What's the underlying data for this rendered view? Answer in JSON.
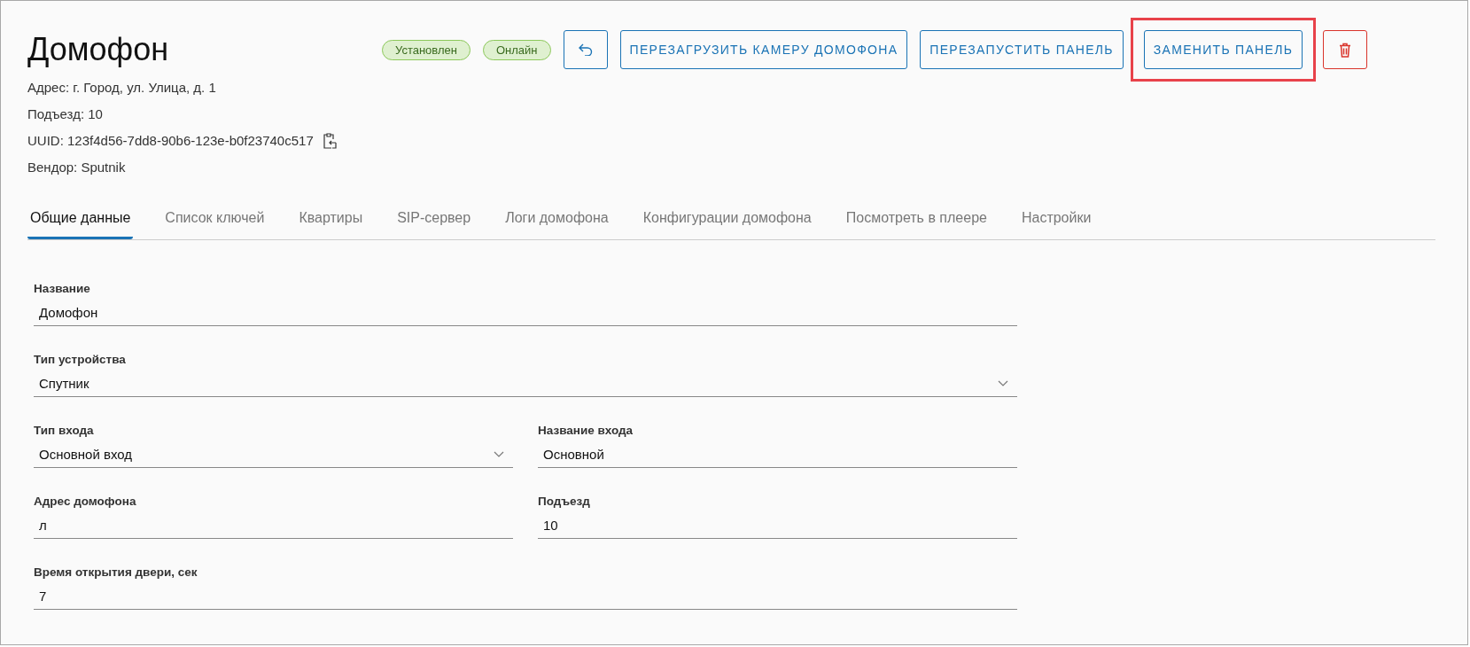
{
  "header": {
    "title": "Домофон",
    "badges": [
      "Установлен",
      "Онлайн"
    ],
    "actions": [
      {
        "kind": "undo",
        "highlighted": false
      },
      {
        "kind": "text",
        "label": "ПЕРЕЗАГРУЗИТЬ КАМЕРУ ДОМОФОНА",
        "highlighted": false
      },
      {
        "kind": "text",
        "label": "ПЕРЕЗАПУСТИТЬ ПАНЕЛЬ",
        "highlighted": false
      },
      {
        "kind": "text",
        "label": "ЗАМЕНИТЬ ПАНЕЛЬ",
        "highlighted": true
      },
      {
        "kind": "delete",
        "highlighted": false
      }
    ],
    "info": [
      {
        "text": "Адрес: г. Город, ул. Улица, д. 1",
        "copy": false
      },
      {
        "text": "Подъезд: 10",
        "copy": false
      },
      {
        "text": "UUID: 123f4d56-7dd8-90b6-123e-b0f23740c517",
        "copy": true
      },
      {
        "text": "Вендор: Sputnik",
        "copy": false
      }
    ]
  },
  "tabs": [
    {
      "label": "Общие данные",
      "selected": true
    },
    {
      "label": "Список ключей",
      "selected": false
    },
    {
      "label": "Квартиры",
      "selected": false
    },
    {
      "label": "SIP-сервер",
      "selected": false
    },
    {
      "label": "Логи домофона",
      "selected": false
    },
    {
      "label": "Конфигурации домофона",
      "selected": false
    },
    {
      "label": "Посмотреть в плеере",
      "selected": false
    },
    {
      "label": "Настройки",
      "selected": false
    }
  ],
  "form": {
    "rows": [
      [
        {
          "label": "Название",
          "value": "Домофон",
          "kind": "text"
        }
      ],
      [
        {
          "label": "Тип устройства",
          "value": "Спутник",
          "kind": "select"
        }
      ],
      [
        {
          "label": "Тип входа",
          "value": "Основной вход",
          "kind": "select"
        },
        {
          "label": "Название входа",
          "value": "Основной",
          "kind": "text"
        }
      ],
      [
        {
          "label": "Адрес домофона",
          "value": "л",
          "kind": "text"
        },
        {
          "label": "Подъезд",
          "value": "10",
          "kind": "text"
        }
      ],
      [
        {
          "label": "Время открытия двери, сек",
          "value": "7",
          "kind": "text"
        }
      ]
    ]
  }
}
